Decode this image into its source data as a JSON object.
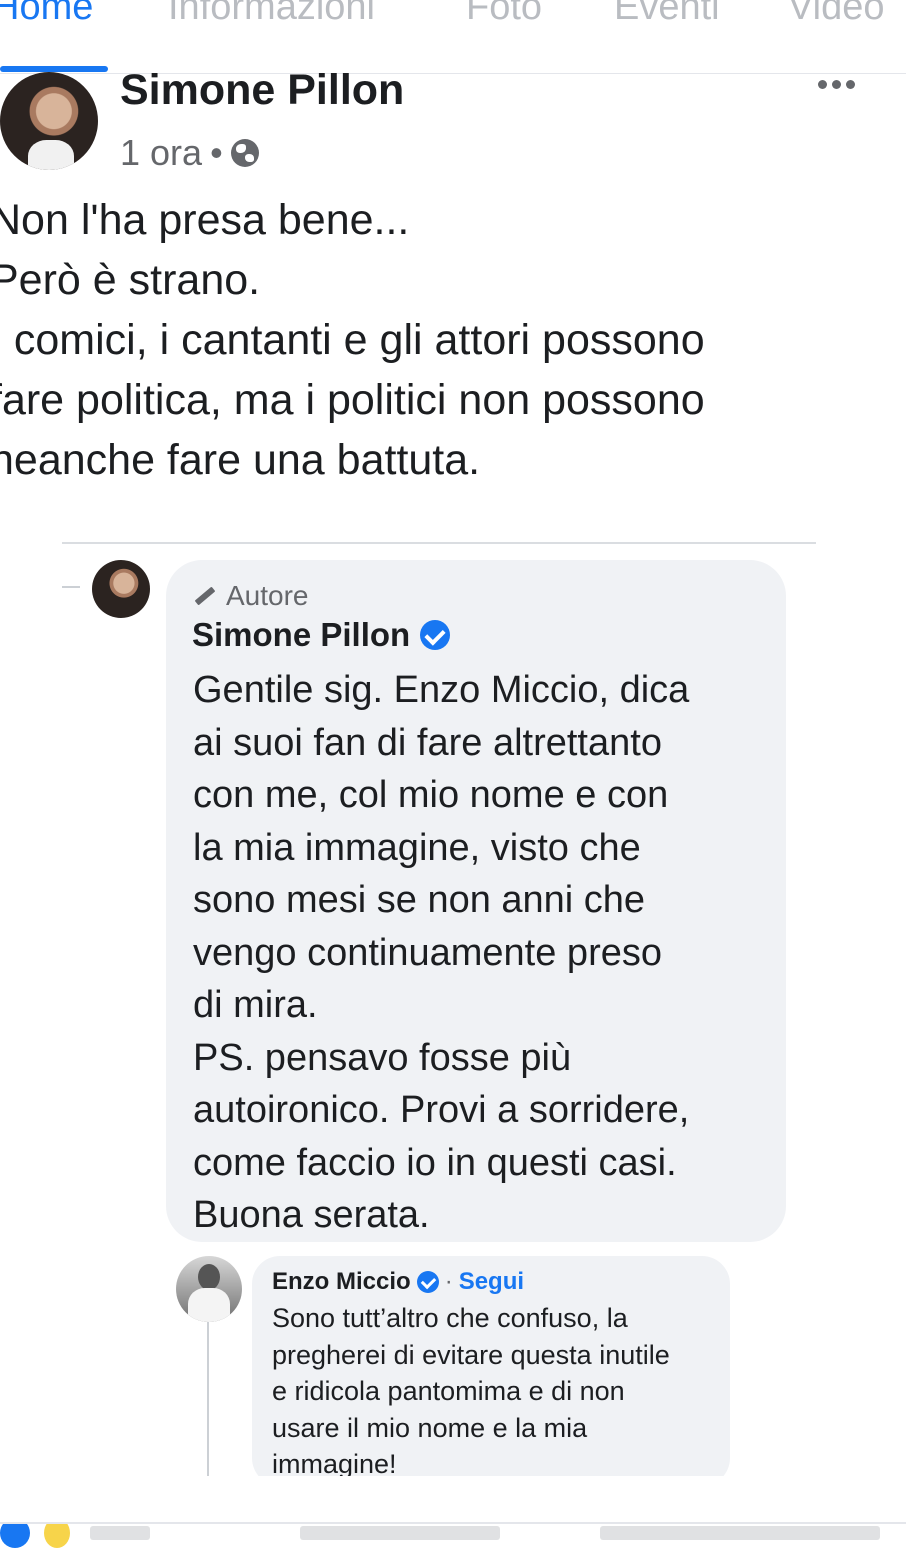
{
  "tabs": [
    {
      "label": "Home",
      "active": true
    },
    {
      "label": "Informazioni",
      "active": false
    },
    {
      "label": "Foto",
      "active": false
    },
    {
      "label": "Eventi",
      "active": false
    },
    {
      "label": "Video",
      "active": false
    }
  ],
  "post": {
    "author": "Simone Pillon",
    "time": "1 ora",
    "dot": "•",
    "text": "Non l'ha presa bene...\nPerò è strano.\nI comici, i cantanti e gli attori possono\nfare politica, ma i politici non possono\nneanche fare una battuta."
  },
  "comment": {
    "badge": "Autore",
    "author": "Simone Pillon",
    "text": "Gentile sig. Enzo Miccio, dica\nai suoi fan di fare altrettanto\ncon me, col mio nome e con\nla mia immagine, visto che\nsono mesi se non anni che\nvengo continuamente preso\ndi mira.\nPS. pensavo fosse più\nautoironico. Provi a sorridere,\ncome faccio io in questi casi.\nBuona serata."
  },
  "reply": {
    "author": "Enzo Miccio",
    "separator": "·",
    "follow_label": "Segui",
    "text": "Sono tutt’altro che confuso, la\npregherei di evitare questa inutile\ne ridicola pantomima e di non\nusare il mio nome e la mia\nimmagine!"
  },
  "colors": {
    "accent": "#1877f2",
    "bubble": "#f0f2f5",
    "muted": "#65676b"
  },
  "icons": [
    "globe-icon",
    "more-options-icon",
    "pencil-icon",
    "verified-icon",
    "like-reaction-icon",
    "haha-reaction-icon"
  ]
}
